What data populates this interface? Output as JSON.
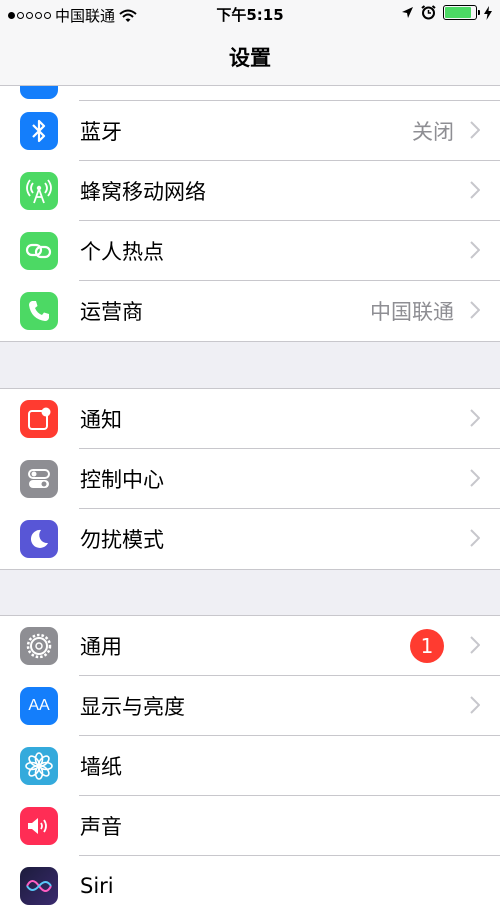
{
  "status_bar": {
    "carrier": "中国联通",
    "time": "下午5:15",
    "battery_color": "#4cd964"
  },
  "nav": {
    "title": "设置"
  },
  "groups": [
    {
      "rows": [
        {
          "label": "蓝牙",
          "value": "关闭",
          "icon": "bluetooth-icon",
          "icon_color": "#147efb"
        },
        {
          "label": "蜂窝移动网络",
          "icon": "cellular-antenna-icon",
          "icon_color": "#4cd964"
        },
        {
          "label": "个人热点",
          "icon": "hotspot-link-icon",
          "icon_color": "#4cd964"
        },
        {
          "label": "运营商",
          "value": "中国联通",
          "icon": "phone-icon",
          "icon_color": "#4cd964"
        }
      ]
    },
    {
      "rows": [
        {
          "label": "通知",
          "icon": "notification-icon",
          "icon_color": "#ff3b30"
        },
        {
          "label": "控制中心",
          "icon": "toggle-switches-icon",
          "icon_color": "#8e8e93"
        },
        {
          "label": "勿扰模式",
          "icon": "moon-icon",
          "icon_color": "#5856d6"
        }
      ]
    },
    {
      "rows": [
        {
          "label": "通用",
          "badge": "1",
          "icon": "gear-icon",
          "icon_color": "#8e8e93"
        },
        {
          "label": "显示与亮度",
          "icon_text": "AA",
          "icon": "text-size-icon",
          "icon_color": "#147efb"
        },
        {
          "label": "墙纸",
          "icon": "flower-icon",
          "icon_color": "#34aadc"
        },
        {
          "label": "声音",
          "icon": "speaker-icon",
          "icon_color": "#ff2d55"
        },
        {
          "label": "Siri",
          "icon": "siri-icon",
          "icon_color": "#1c1c3c"
        }
      ]
    }
  ]
}
